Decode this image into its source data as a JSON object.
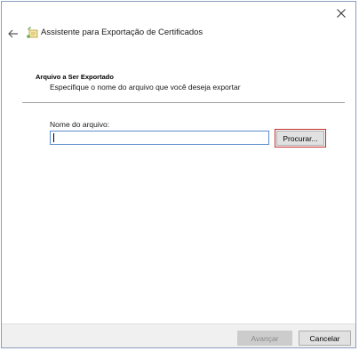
{
  "window": {
    "title": "Assistente para Exportação de Certificados",
    "close_icon": "close-icon",
    "back_icon": "back-arrow-icon",
    "wizard_icon": "certificate-wizard-icon"
  },
  "section": {
    "heading": "Arquivo a Ser Exportado",
    "description": "Especifique o nome do arquivo que você deseja exportar"
  },
  "file": {
    "label": "Nome do arquivo:",
    "value": "",
    "browse_label": "Procurar..."
  },
  "footer": {
    "next_label": "Avançar",
    "cancel_label": "Cancelar"
  },
  "colors": {
    "highlight_border": "#c42b2b",
    "input_border": "#5b8ecf",
    "disabled_text": "#8a8a8a"
  }
}
